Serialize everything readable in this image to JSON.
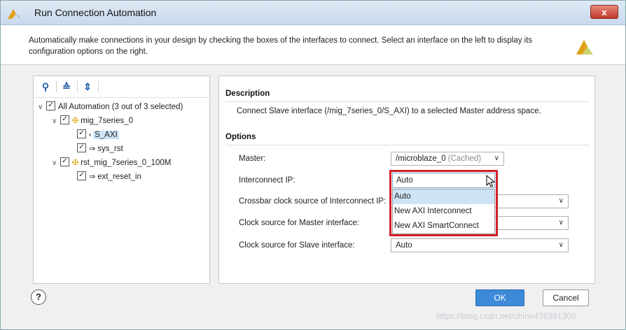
{
  "window": {
    "title": "Run Connection Automation",
    "close_label": "x"
  },
  "header": {
    "text": "Automatically make connections in your design by checking the boxes of the interfaces to connect. Select an interface on the left to display its configuration options on the right."
  },
  "tree": {
    "items": [
      {
        "label": "All Automation (3 out of 3 selected)",
        "checked": true
      },
      {
        "label": "mig_7series_0",
        "checked": true
      },
      {
        "label": "S_AXI",
        "checked": true
      },
      {
        "label": "sys_rst",
        "checked": true
      },
      {
        "label": "rst_mig_7series_0_100M",
        "checked": true
      },
      {
        "label": "ext_reset_in",
        "checked": true
      }
    ]
  },
  "description": {
    "heading": "Description",
    "text": "Connect Slave interface (/mig_7series_0/S_AXI) to a selected Master address space."
  },
  "options": {
    "heading": "Options",
    "master_label": "Master:",
    "master_value": "/microblaze_0",
    "master_note": "(Cached)",
    "interconnect_label": "Interconnect IP:",
    "interconnect_value": "Auto",
    "crossbar_label": "Crossbar clock source of Interconnect IP:",
    "master_clock_label": "Clock source for Master interface:",
    "slave_clock_label": "Clock source for Slave interface:",
    "slave_clock_value": "Auto",
    "dropdown_options": [
      "Auto",
      "New AXI Interconnect",
      "New AXI SmartConnect"
    ]
  },
  "footer": {
    "help_label": "?",
    "ok_label": "OK",
    "cancel_label": "Cancel"
  },
  "watermark": "https://blog.csdn.net/chinn476391300",
  "colors": {
    "accent": "#3c8ad8",
    "highlight_outline": "#d4202a"
  }
}
